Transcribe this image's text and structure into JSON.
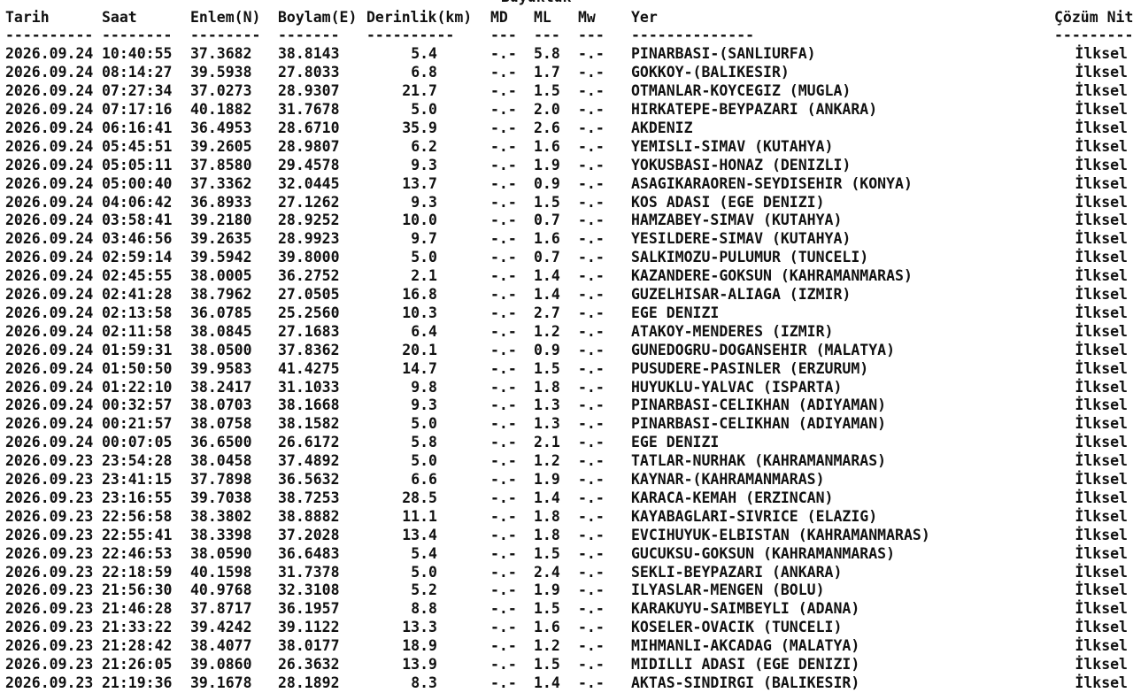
{
  "magnitude_group_label": "Büyüklük",
  "headers": {
    "tarih": "Tarih",
    "saat": "Saat",
    "enlem": "Enlem(N)",
    "boylam": "Boylam(E)",
    "derinlik": "Derinlik(km)",
    "md": "MD",
    "ml": "ML",
    "mw": "Mw",
    "yer": "Yer",
    "cozum": "Çözüm Nit"
  },
  "separators": {
    "tarih": "----------",
    "saat": "--------",
    "enlem": "--------",
    "boylam": "-------",
    "derinlik": "----------",
    "md": "---",
    "ml": "---",
    "mw": "---",
    "yer": "--------------",
    "cozum": "---------"
  },
  "rows": [
    {
      "date": "2026.09.24",
      "time": "10:40:55",
      "lat": "37.3682",
      "lon": "38.8143",
      "depth": "5.4",
      "md": "-.-",
      "ml": "5.8",
      "mw": "-.-",
      "place": "PINARBASI-(SANLIURFA)",
      "quality": "İlksel"
    },
    {
      "date": "2026.09.24",
      "time": "08:14:27",
      "lat": "39.5938",
      "lon": "27.8033",
      "depth": "6.8",
      "md": "-.-",
      "ml": "1.7",
      "mw": "-.-",
      "place": "GOKKOY-(BALIKESIR)",
      "quality": "İlksel"
    },
    {
      "date": "2026.09.24",
      "time": "07:27:34",
      "lat": "37.0273",
      "lon": "28.9307",
      "depth": "21.7",
      "md": "-.-",
      "ml": "1.5",
      "mw": "-.-",
      "place": "OTMANLAR-KOYCEGIZ (MUGLA)",
      "quality": "İlksel"
    },
    {
      "date": "2026.09.24",
      "time": "07:17:16",
      "lat": "40.1882",
      "lon": "31.7678",
      "depth": "5.0",
      "md": "-.-",
      "ml": "2.0",
      "mw": "-.-",
      "place": "HIRKATEPE-BEYPAZARI (ANKARA)",
      "quality": "İlksel"
    },
    {
      "date": "2026.09.24",
      "time": "06:16:41",
      "lat": "36.4953",
      "lon": "28.6710",
      "depth": "35.9",
      "md": "-.-",
      "ml": "2.6",
      "mw": "-.-",
      "place": "AKDENIZ",
      "quality": "İlksel"
    },
    {
      "date": "2026.09.24",
      "time": "05:45:51",
      "lat": "39.2605",
      "lon": "28.9807",
      "depth": "6.2",
      "md": "-.-",
      "ml": "1.6",
      "mw": "-.-",
      "place": "YEMISLI-SIMAV (KUTAHYA)",
      "quality": "İlksel"
    },
    {
      "date": "2026.09.24",
      "time": "05:05:11",
      "lat": "37.8580",
      "lon": "29.4578",
      "depth": "9.3",
      "md": "-.-",
      "ml": "1.9",
      "mw": "-.-",
      "place": "YOKUSBASI-HONAZ (DENIZLI)",
      "quality": "İlksel"
    },
    {
      "date": "2026.09.24",
      "time": "05:00:40",
      "lat": "37.3362",
      "lon": "32.0445",
      "depth": "13.7",
      "md": "-.-",
      "ml": "0.9",
      "mw": "-.-",
      "place": "ASAGIKARAOREN-SEYDISEHIR (KONYA)",
      "quality": "İlksel"
    },
    {
      "date": "2026.09.24",
      "time": "04:06:42",
      "lat": "36.8933",
      "lon": "27.1262",
      "depth": "9.3",
      "md": "-.-",
      "ml": "1.5",
      "mw": "-.-",
      "place": "KOS ADASI (EGE DENIZI)",
      "quality": "İlksel"
    },
    {
      "date": "2026.09.24",
      "time": "03:58:41",
      "lat": "39.2180",
      "lon": "28.9252",
      "depth": "10.0",
      "md": "-.-",
      "ml": "0.7",
      "mw": "-.-",
      "place": "HAMZABEY-SIMAV (KUTAHYA)",
      "quality": "İlksel"
    },
    {
      "date": "2026.09.24",
      "time": "03:46:56",
      "lat": "39.2635",
      "lon": "28.9923",
      "depth": "9.7",
      "md": "-.-",
      "ml": "1.6",
      "mw": "-.-",
      "place": "YESILDERE-SIMAV (KUTAHYA)",
      "quality": "İlksel"
    },
    {
      "date": "2026.09.24",
      "time": "02:59:14",
      "lat": "39.5942",
      "lon": "39.8000",
      "depth": "5.0",
      "md": "-.-",
      "ml": "0.7",
      "mw": "-.-",
      "place": "SALKIMOZU-PULUMUR (TUNCELI)",
      "quality": "İlksel"
    },
    {
      "date": "2026.09.24",
      "time": "02:45:55",
      "lat": "38.0005",
      "lon": "36.2752",
      "depth": "2.1",
      "md": "-.-",
      "ml": "1.4",
      "mw": "-.-",
      "place": "KAZANDERE-GOKSUN (KAHRAMANMARAS)",
      "quality": "İlksel"
    },
    {
      "date": "2026.09.24",
      "time": "02:41:28",
      "lat": "38.7962",
      "lon": "27.0505",
      "depth": "16.8",
      "md": "-.-",
      "ml": "1.4",
      "mw": "-.-",
      "place": "GUZELHISAR-ALIAGA (IZMIR)",
      "quality": "İlksel"
    },
    {
      "date": "2026.09.24",
      "time": "02:13:58",
      "lat": "36.0785",
      "lon": "25.2560",
      "depth": "10.3",
      "md": "-.-",
      "ml": "2.7",
      "mw": "-.-",
      "place": "EGE DENIZI",
      "quality": "İlksel"
    },
    {
      "date": "2026.09.24",
      "time": "02:11:58",
      "lat": "38.0845",
      "lon": "27.1683",
      "depth": "6.4",
      "md": "-.-",
      "ml": "1.2",
      "mw": "-.-",
      "place": "ATAKOY-MENDERES (IZMIR)",
      "quality": "İlksel"
    },
    {
      "date": "2026.09.24",
      "time": "01:59:31",
      "lat": "38.0500",
      "lon": "37.8362",
      "depth": "20.1",
      "md": "-.-",
      "ml": "0.9",
      "mw": "-.-",
      "place": "GUNEDOGRU-DOGANSEHIR (MALATYA)",
      "quality": "İlksel"
    },
    {
      "date": "2026.09.24",
      "time": "01:50:50",
      "lat": "39.9583",
      "lon": "41.4275",
      "depth": "14.7",
      "md": "-.-",
      "ml": "1.5",
      "mw": "-.-",
      "place": "PUSUDERE-PASINLER (ERZURUM)",
      "quality": "İlksel"
    },
    {
      "date": "2026.09.24",
      "time": "01:22:10",
      "lat": "38.2417",
      "lon": "31.1033",
      "depth": "9.8",
      "md": "-.-",
      "ml": "1.8",
      "mw": "-.-",
      "place": "HUYUKLU-YALVAC (ISPARTA)",
      "quality": "İlksel"
    },
    {
      "date": "2026.09.24",
      "time": "00:32:57",
      "lat": "38.0703",
      "lon": "38.1668",
      "depth": "9.3",
      "md": "-.-",
      "ml": "1.3",
      "mw": "-.-",
      "place": "PINARBASI-CELIKHAN (ADIYAMAN)",
      "quality": "İlksel"
    },
    {
      "date": "2026.09.24",
      "time": "00:21:57",
      "lat": "38.0758",
      "lon": "38.1582",
      "depth": "5.0",
      "md": "-.-",
      "ml": "1.3",
      "mw": "-.-",
      "place": "PINARBASI-CELIKHAN (ADIYAMAN)",
      "quality": "İlksel"
    },
    {
      "date": "2026.09.24",
      "time": "00:07:05",
      "lat": "36.6500",
      "lon": "26.6172",
      "depth": "5.8",
      "md": "-.-",
      "ml": "2.1",
      "mw": "-.-",
      "place": "EGE DENIZI",
      "quality": "İlksel"
    },
    {
      "date": "2026.09.23",
      "time": "23:54:28",
      "lat": "38.0458",
      "lon": "37.4892",
      "depth": "5.0",
      "md": "-.-",
      "ml": "1.2",
      "mw": "-.-",
      "place": "TATLAR-NURHAK (KAHRAMANMARAS)",
      "quality": "İlksel"
    },
    {
      "date": "2026.09.23",
      "time": "23:41:15",
      "lat": "37.7898",
      "lon": "36.5632",
      "depth": "6.6",
      "md": "-.-",
      "ml": "1.9",
      "mw": "-.-",
      "place": "KAYNAR-(KAHRAMANMARAS)",
      "quality": "İlksel"
    },
    {
      "date": "2026.09.23",
      "time": "23:16:55",
      "lat": "39.7038",
      "lon": "38.7253",
      "depth": "28.5",
      "md": "-.-",
      "ml": "1.4",
      "mw": "-.-",
      "place": "KARACA-KEMAH (ERZINCAN)",
      "quality": "İlksel"
    },
    {
      "date": "2026.09.23",
      "time": "22:56:58",
      "lat": "38.3802",
      "lon": "38.8882",
      "depth": "11.1",
      "md": "-.-",
      "ml": "1.8",
      "mw": "-.-",
      "place": "KAYABAGLARI-SIVRICE (ELAZIG)",
      "quality": "İlksel"
    },
    {
      "date": "2026.09.23",
      "time": "22:55:41",
      "lat": "38.3398",
      "lon": "37.2028",
      "depth": "13.4",
      "md": "-.-",
      "ml": "1.8",
      "mw": "-.-",
      "place": "EVCIHUYUK-ELBISTAN (KAHRAMANMARAS)",
      "quality": "İlksel"
    },
    {
      "date": "2026.09.23",
      "time": "22:46:53",
      "lat": "38.0590",
      "lon": "36.6483",
      "depth": "5.4",
      "md": "-.-",
      "ml": "1.5",
      "mw": "-.-",
      "place": "GUCUKSU-GOKSUN (KAHRAMANMARAS)",
      "quality": "İlksel"
    },
    {
      "date": "2026.09.23",
      "time": "22:18:59",
      "lat": "40.1598",
      "lon": "31.7378",
      "depth": "5.0",
      "md": "-.-",
      "ml": "2.4",
      "mw": "-.-",
      "place": "SEKLI-BEYPAZARI (ANKARA)",
      "quality": "İlksel"
    },
    {
      "date": "2026.09.23",
      "time": "21:56:30",
      "lat": "40.9768",
      "lon": "32.3108",
      "depth": "5.2",
      "md": "-.-",
      "ml": "1.9",
      "mw": "-.-",
      "place": "ILYASLAR-MENGEN (BOLU)",
      "quality": "İlksel"
    },
    {
      "date": "2026.09.23",
      "time": "21:46:28",
      "lat": "37.8717",
      "lon": "36.1957",
      "depth": "8.8",
      "md": "-.-",
      "ml": "1.5",
      "mw": "-.-",
      "place": "KARAKUYU-SAIMBEYLI (ADANA)",
      "quality": "İlksel"
    },
    {
      "date": "2026.09.23",
      "time": "21:33:22",
      "lat": "39.4242",
      "lon": "39.1122",
      "depth": "13.3",
      "md": "-.-",
      "ml": "1.6",
      "mw": "-.-",
      "place": "KOSELER-OVACIK (TUNCELI)",
      "quality": "İlksel"
    },
    {
      "date": "2026.09.23",
      "time": "21:28:42",
      "lat": "38.4077",
      "lon": "38.0177",
      "depth": "18.9",
      "md": "-.-",
      "ml": "1.2",
      "mw": "-.-",
      "place": "MIHMANLI-AKCADAG (MALATYA)",
      "quality": "İlksel"
    },
    {
      "date": "2026.09.23",
      "time": "21:26:05",
      "lat": "39.0860",
      "lon": "26.3632",
      "depth": "13.9",
      "md": "-.-",
      "ml": "1.5",
      "mw": "-.-",
      "place": "MIDILLI ADASI (EGE DENIZI)",
      "quality": "İlksel"
    },
    {
      "date": "2026.09.23",
      "time": "21:19:36",
      "lat": "39.1678",
      "lon": "28.1892",
      "depth": "8.3",
      "md": "-.-",
      "ml": "1.4",
      "mw": "-.-",
      "place": "AKTAS-SINDIRGI (BALIKESIR)",
      "quality": "İlksel"
    }
  ]
}
